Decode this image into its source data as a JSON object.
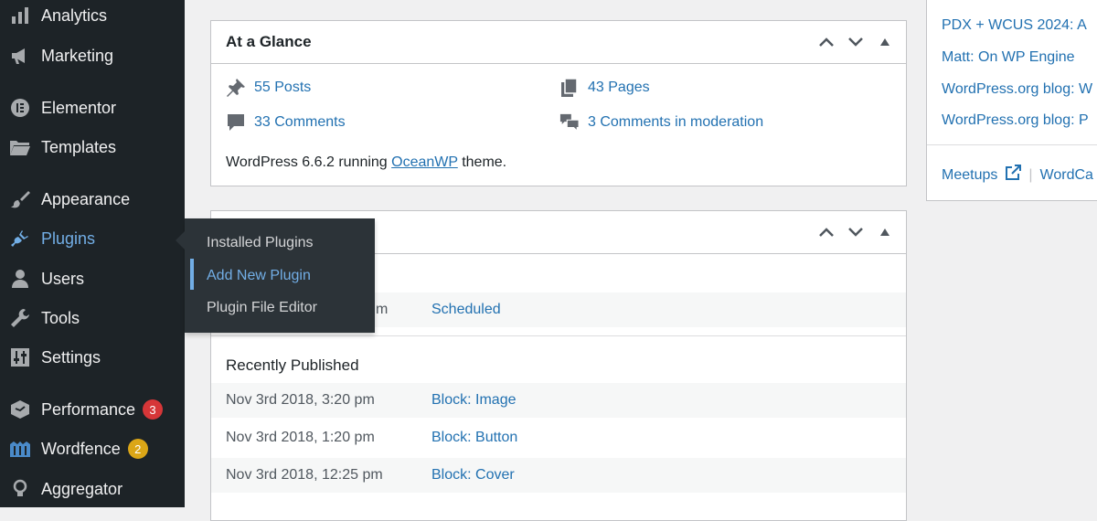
{
  "sidebar": {
    "items": [
      {
        "label": "Analytics",
        "icon": "bar-chart-icon"
      },
      {
        "label": "Marketing",
        "icon": "megaphone-icon"
      },
      {
        "label": "Elementor",
        "icon": "elementor-icon"
      },
      {
        "label": "Templates",
        "icon": "folder-icon"
      },
      {
        "label": "Appearance",
        "icon": "paintbrush-icon"
      },
      {
        "label": "Plugins",
        "icon": "plug-icon"
      },
      {
        "label": "Users",
        "icon": "user-icon"
      },
      {
        "label": "Tools",
        "icon": "wrench-icon"
      },
      {
        "label": "Settings",
        "icon": "sliders-icon"
      },
      {
        "label": "Performance",
        "icon": "performance-icon",
        "badge": "3"
      },
      {
        "label": "Wordfence",
        "icon": "wordfence-icon",
        "badge": "2"
      },
      {
        "label": "Aggregator",
        "icon": "lightbulb-icon"
      }
    ],
    "flyout": {
      "items": [
        "Installed Plugins",
        "Add New Plugin",
        "Plugin File Editor"
      ],
      "current": "Add New Plugin"
    }
  },
  "at_a_glance": {
    "title": "At a Glance",
    "posts": "55 Posts",
    "pages": "43 Pages",
    "comments": "33 Comments",
    "moderation": "3 Comments in moderation",
    "footer_prefix": "WordPress 6.6.2 running ",
    "theme": "OceanWP",
    "footer_suffix": " theme."
  },
  "activity": {
    "scheduled_time_fragment": "m",
    "scheduled_label": "Scheduled",
    "recently_published_heading": "Recently Published",
    "rows": [
      {
        "date": "Nov 3rd 2018, 3:20 pm",
        "title": "Block: Image"
      },
      {
        "date": "Nov 3rd 2018, 1:20 pm",
        "title": "Block: Button"
      },
      {
        "date": "Nov 3rd 2018, 12:25 pm",
        "title": "Block: Cover"
      }
    ]
  },
  "news": {
    "links": [
      "PDX + WCUS 2024: A",
      "Matt: On WP Engine",
      "WordPress.org blog: W",
      "WordPress.org blog: P"
    ],
    "meetups": "Meetups",
    "wordcamps": "WordCa"
  },
  "colors": {
    "sidebar_bg": "#1d2327",
    "accent": "#72aee6",
    "link": "#2271b1",
    "badge_red": "#d63638",
    "badge_orange": "#dba617"
  }
}
